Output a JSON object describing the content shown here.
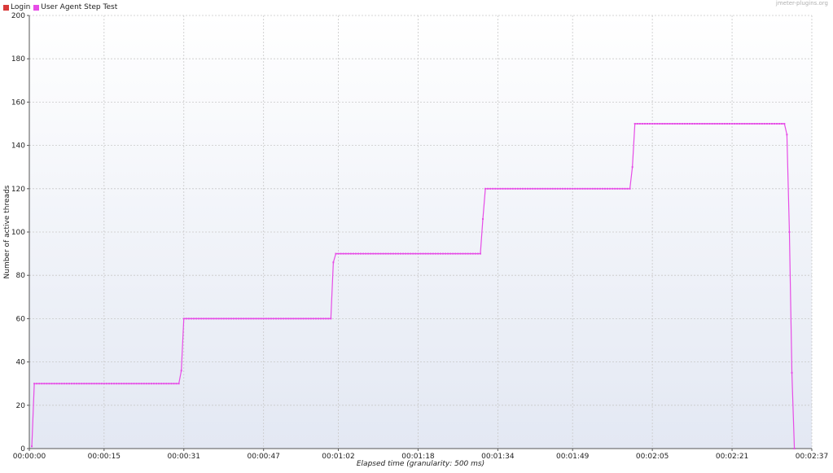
{
  "watermark": "jmeter-plugins.org",
  "legend": [
    {
      "label": "Login",
      "color": "#d93a3a"
    },
    {
      "label": "User Agent Step Test",
      "color": "#e64ce6"
    }
  ],
  "chart_data": {
    "type": "line",
    "title": "",
    "xlabel": "Elapsed time (granularity: 500 ms)",
    "ylabel": "Number of active threads",
    "ylim": [
      0,
      200
    ],
    "xlim": [
      0,
      157
    ],
    "y_ticks": [
      0,
      20,
      40,
      60,
      80,
      100,
      120,
      140,
      160,
      180,
      200
    ],
    "x_ticks": [
      {
        "value": 0,
        "label": "00:00:00"
      },
      {
        "value": 15,
        "label": "00:00:15"
      },
      {
        "value": 31,
        "label": "00:00:31"
      },
      {
        "value": 47,
        "label": "00:00:47"
      },
      {
        "value": 62,
        "label": "00:01:02"
      },
      {
        "value": 78,
        "label": "00:01:18"
      },
      {
        "value": 94,
        "label": "00:01:34"
      },
      {
        "value": 109,
        "label": "00:01:49"
      },
      {
        "value": 125,
        "label": "00:02:05"
      },
      {
        "value": 141,
        "label": "00:02:21"
      },
      {
        "value": 157,
        "label": "00:02:37"
      }
    ],
    "grid": true,
    "legend_position": "top-left",
    "series": [
      {
        "name": "User Agent Step Test",
        "color": "#e64ce6",
        "x": [
          0.5,
          1,
          30,
          30.5,
          31,
          60.5,
          61,
          61.5,
          90.5,
          91,
          91.5,
          120.5,
          121,
          121.5,
          151.5,
          152,
          152.5,
          153,
          153.5
        ],
        "y": [
          1,
          30,
          30,
          36,
          60,
          60,
          86,
          90,
          90,
          106,
          120,
          120,
          130,
          150,
          150,
          145,
          100,
          35,
          0
        ]
      }
    ]
  }
}
